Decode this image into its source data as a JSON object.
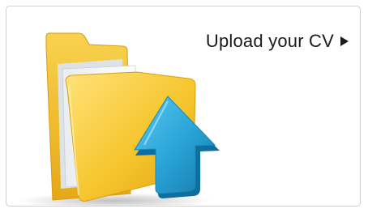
{
  "card": {
    "cta_label": "Upload your CV",
    "cta_icon": "play-arrow-icon"
  },
  "illustration": {
    "folder_icon": "folder-icon",
    "upload_icon": "upload-arrow-icon"
  },
  "colors": {
    "folder_yellow": "#F6C62E",
    "upload_blue": "#29A7DA",
    "text": "#1B1B1B",
    "border": "#CFCFCF"
  }
}
